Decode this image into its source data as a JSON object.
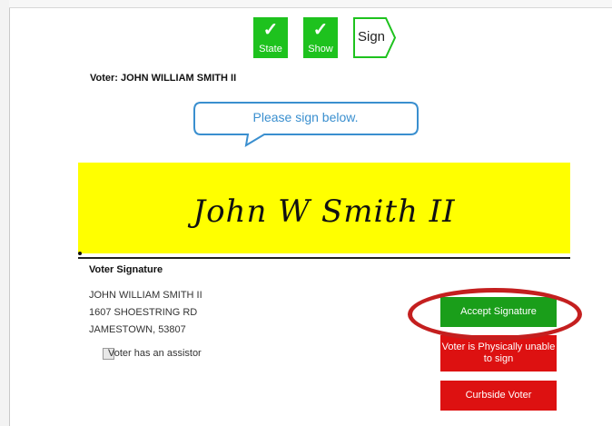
{
  "steps": [
    {
      "label": "State",
      "check": "✓"
    },
    {
      "label": "Show",
      "check": "✓"
    },
    {
      "label": "Sign"
    }
  ],
  "voter_line": "Voter: JOHN WILLIAM SMITH II",
  "prompt": "Please sign below.",
  "signature_text": "John W Smith II",
  "signature_heading": "Voter Signature",
  "address": {
    "name": "JOHN WILLIAM SMITH II",
    "street": "1607 SHOESTRING RD",
    "city": "JAMESTOWN, 53807"
  },
  "assistor_label": "Voter has an assistor",
  "buttons": {
    "accept": "Accept Signature",
    "unable": "Voter is Physically unable to sign",
    "curbside": "Curbside Voter"
  },
  "colors": {
    "step_done": "#1ec21e",
    "accept": "#1a9e1a",
    "danger": "#dd1111",
    "pad": "#ffff00",
    "bubble": "#3a8fcf",
    "highlight": "#c41f1f"
  }
}
